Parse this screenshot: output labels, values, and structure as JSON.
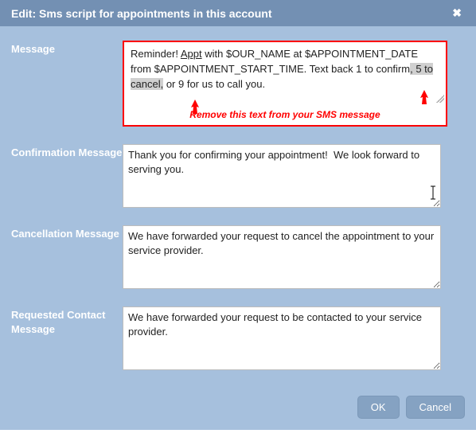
{
  "dialog": {
    "title": "Edit: Sms script for appointments in this account"
  },
  "fields": {
    "message": {
      "label": "Message",
      "value_pre_hl1": "Reminder! ",
      "value_u": "Appt",
      "value_mid1": " with $OUR_NAME at $APPOINTMENT_DATE from $APPOINTMENT_START_TIME.  Text back 1 to confirm",
      "value_hl1": ", 5 to cancel,",
      "value_post": " or 9 for us to call you.",
      "annotation": "Remove this text from your SMS message"
    },
    "confirmation": {
      "label": "Confirmation Message",
      "value": "Thank you for confirming your appointment!  We look forward to serving you."
    },
    "cancellation": {
      "label": "Cancellation Message",
      "value": "We have forwarded your request to cancel the appointment to your service provider."
    },
    "requested": {
      "label": "Requested Contact Message",
      "value": "We have forwarded your request to be contacted to your service provider."
    }
  },
  "buttons": {
    "ok": "OK",
    "cancel": "Cancel"
  }
}
